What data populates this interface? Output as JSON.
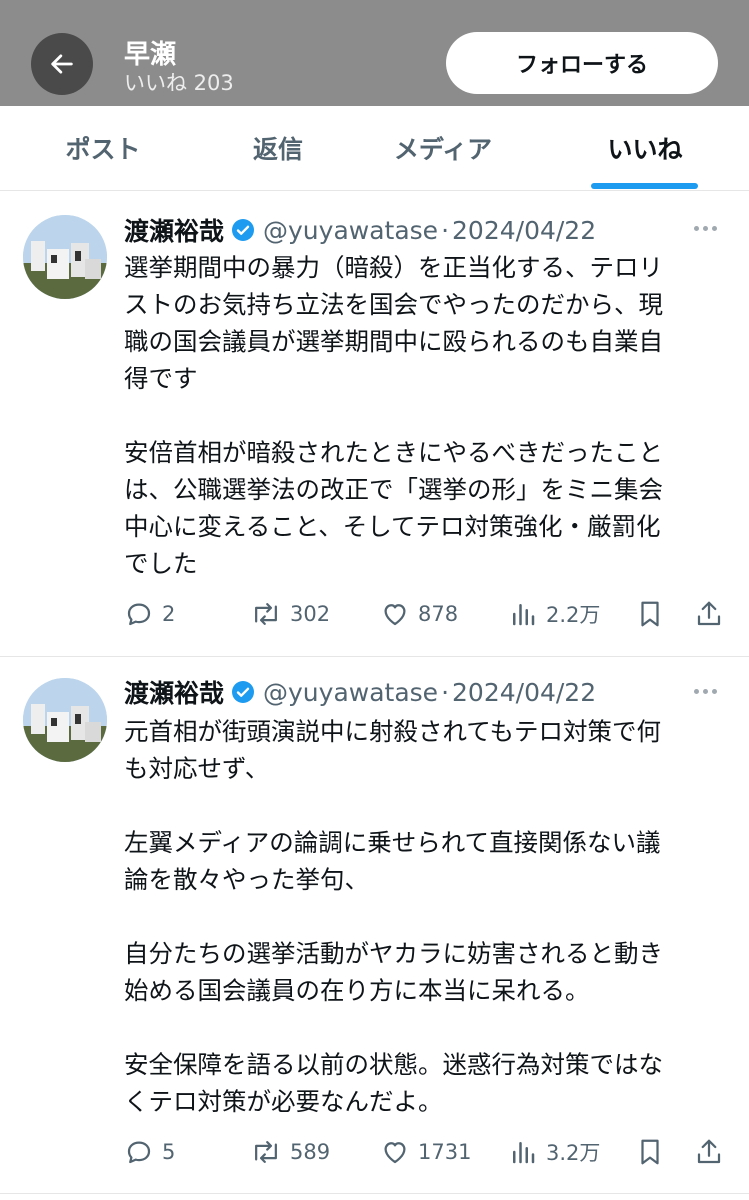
{
  "header": {
    "name": "早瀬",
    "likes_count": "いいね 203",
    "follow_label": "フォローする"
  },
  "tabs": [
    {
      "label": "ポスト"
    },
    {
      "label": "返信"
    },
    {
      "label": "メディア"
    },
    {
      "label": "いいね",
      "active": true
    }
  ],
  "colors": {
    "accent": "#1d9bf0",
    "verified": "#1d9bf0",
    "header_bg": "#8c8c8c"
  },
  "posts": [
    {
      "author": "渡瀬裕哉",
      "handle": "@yuyawatase",
      "dot": "·",
      "date": "2024/04/22",
      "lines": [
        "選挙期間中の暴力（暗殺）を正当化する、テロリ",
        "ストのお気持ち立法を国会でやったのだから、現",
        "職の国会議員が選挙期間中に殴られるのも自業自",
        "得です",
        "",
        "安倍首相が暗殺されたときにやるべきだったこと",
        "は、公職選挙法の改正で「選挙の形」をミニ集会",
        "中心に変えること、そしてテロ対策強化・厳罰化",
        "でした"
      ],
      "replies": "2",
      "reposts": "302",
      "likes": "878",
      "views": "2.2万"
    },
    {
      "author": "渡瀬裕哉",
      "handle": "@yuyawatase",
      "dot": "·",
      "date": "2024/04/22",
      "lines": [
        "元首相が街頭演説中に射殺されてもテロ対策で何",
        "も対応せず、",
        "",
        "左翼メディアの論調に乗せられて直接関係ない議",
        "論を散々やった挙句、",
        "",
        "自分たちの選挙活動がヤカラに妨害されると動き",
        "始める国会議員の在り方に本当に呆れる。",
        "",
        "安全保障を語る以前の状態。迷惑行為対策ではな",
        "くテロ対策が必要なんだよ。"
      ],
      "replies": "5",
      "reposts": "589",
      "likes": "1731",
      "views": "3.2万"
    }
  ]
}
